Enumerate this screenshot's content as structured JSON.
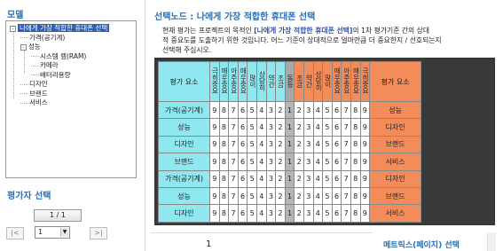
{
  "left_panel": {
    "title": "모델",
    "tree": [
      {
        "label": "나에게 가장 적합한 휴대폰 선택",
        "level": 0,
        "toggle": "-",
        "selected": true
      },
      {
        "label": "가격(공기계)",
        "level": 1,
        "toggle": ""
      },
      {
        "label": "성능",
        "level": 1,
        "toggle": "-"
      },
      {
        "label": "시스템 램(RAM)",
        "level": 2,
        "toggle": ""
      },
      {
        "label": "카메라",
        "level": 2,
        "toggle": ""
      },
      {
        "label": "배터리용량",
        "level": 2,
        "toggle": ""
      },
      {
        "label": "디자인",
        "level": 1,
        "toggle": ""
      },
      {
        "label": "브랜드",
        "level": 1,
        "toggle": ""
      },
      {
        "label": "서비스",
        "level": 1,
        "toggle": ""
      }
    ],
    "evaluator_title": "평가자 선택",
    "page_indicator": "1 / 1",
    "prev_button": "|<",
    "next_button": ">|",
    "evaluator_select": "1"
  },
  "right_panel": {
    "title": "선택노드 : 나에게 가장 적합한 휴대폰 선택",
    "desc_line1_pre": "현재 평가는 프로젝트의 목적인 ",
    "desc_line1_hl": "[나에게 가장 적합한 휴대폰 선택]",
    "desc_line1_post": "의 1차 평가기준 간의 상대",
    "desc_line2": "적 중요도를 도출하기 위한 것입니다. 어느 기준이 상대적으로 얼마만큼 더 중요한지 / 선호되는지",
    "desc_line3": "선택해 주십시오.",
    "matrix": {
      "left_header": "평가 요소",
      "right_header": "평가 요소",
      "left_scale": [
        "극히중요",
        "매우중요",
        "아주중요",
        "매우중요",
        "많이",
        "상당히",
        "약간",
        "조금"
      ],
      "center_scale": "동등",
      "right_scale": [
        "조금",
        "약간",
        "상당히",
        "많이",
        "매우중요",
        "아주중요",
        "매우중요",
        "극히중요"
      ],
      "numbers_left": [
        "9",
        "8",
        "7",
        "6",
        "5",
        "4",
        "3",
        "2"
      ],
      "number_center": "1",
      "numbers_right": [
        "2",
        "3",
        "4",
        "5",
        "6",
        "7",
        "8",
        "9"
      ],
      "rows": [
        {
          "left": "가격(공기계)",
          "right": "성능"
        },
        {
          "left": "성능",
          "right": "디자인"
        },
        {
          "left": "디자인",
          "right": "브랜드"
        },
        {
          "left": "브랜드",
          "right": "서비스"
        },
        {
          "left": "가격(공기계)",
          "right": "디자인"
        },
        {
          "left": "성능",
          "right": "브랜드"
        },
        {
          "left": "디자인",
          "right": "서비스"
        }
      ]
    },
    "bottom_number": "1",
    "bottom_label": "메트릭스(페이지) 선택"
  },
  "colors": {
    "accent": "#2a6fb0",
    "left_cyan": "#8fe8ef",
    "right_orange": "#f38c59",
    "center_gray": "#a8a8a8",
    "matrix_border": "#3a3a3a"
  }
}
